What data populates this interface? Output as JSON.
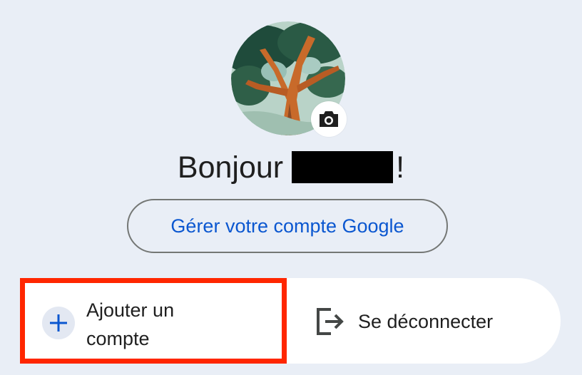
{
  "profile": {
    "greeting_prefix": "Bonjour",
    "greeting_suffix": "!",
    "avatar_icon": "profile-photo-tree",
    "camera_icon": "camera-icon"
  },
  "manage_account": {
    "label": "Gérer votre compte Google"
  },
  "actions": {
    "add_account_label": "Ajouter un compte",
    "add_icon": "plus-icon",
    "sign_out_label": "Se déconnecter",
    "sign_out_icon": "logout-icon"
  },
  "colors": {
    "background": "#e9eef6",
    "accent_blue": "#0b57d0",
    "highlight_red": "#ff2600",
    "text": "#1f1f1f"
  }
}
